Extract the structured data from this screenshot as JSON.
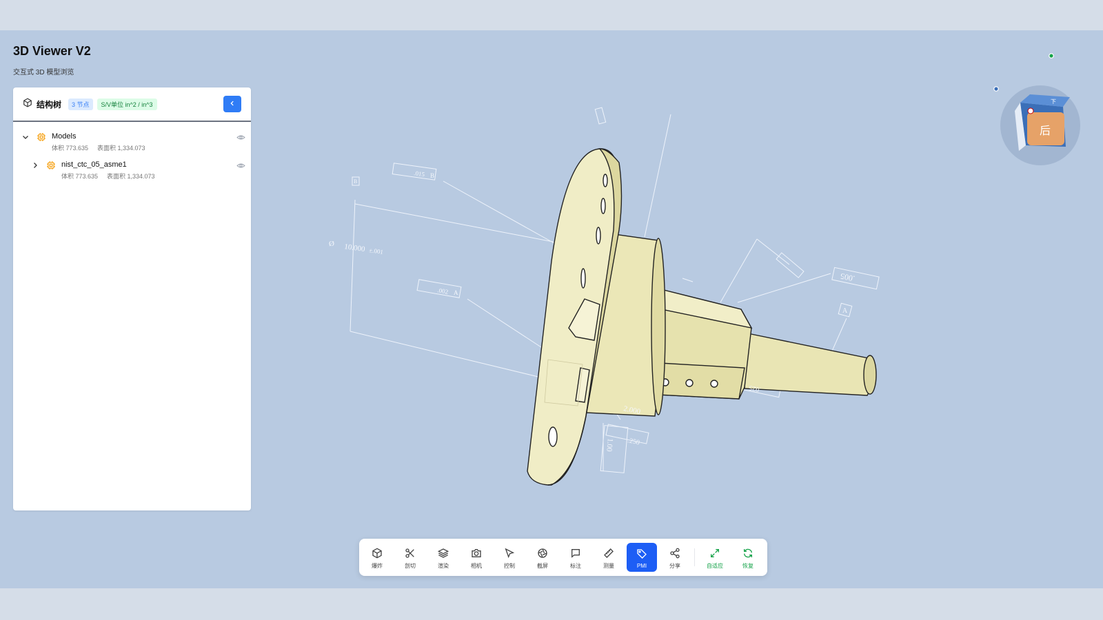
{
  "app": {
    "title": "3D Viewer V2",
    "subtitle": "交互式 3D 模型浏览"
  },
  "panel": {
    "title": "结构树",
    "nodes_badge": "3 节点",
    "units_badge": "S/V单位 in^2 / in^3",
    "tree": [
      {
        "name": "Models",
        "volume": "体积 773.635",
        "area": "表面积 1,334.073",
        "expanded": true
      },
      {
        "name": "nist_ctc_05_asme1",
        "volume": "体积 773.635",
        "area": "表面积 1,334.073",
        "expanded": false
      }
    ]
  },
  "pmi": {
    "dim_diameter_symbol": "Ø",
    "dim_diameter": "10.000",
    "dim_tol": "±.001",
    "fcf_1_tol": ".015",
    "fcf_1_datum": "B",
    "fcf_2_tol": ".002",
    "fcf_2_datum": "A",
    "datum_b": "B",
    "datum_a": "A",
    "fcf_3_tol": ".005",
    "fcf_4_tol": ".025",
    "dim_1": "2.000",
    "dim_2": ".250",
    "dim_3": "1.00"
  },
  "viewcube": {
    "face_label": "后",
    "top_label": "下"
  },
  "toolbar": {
    "items": [
      {
        "key": "explode",
        "label": "爆炸",
        "icon": "cube-icon"
      },
      {
        "key": "section",
        "label": "剖切",
        "icon": "scissors-icon"
      },
      {
        "key": "render",
        "label": "渲染",
        "icon": "layers-icon"
      },
      {
        "key": "camera",
        "label": "相机",
        "icon": "camera-icon"
      },
      {
        "key": "control",
        "label": "控制",
        "icon": "cursor-icon"
      },
      {
        "key": "screenshot",
        "label": "截屏",
        "icon": "aperture-icon"
      },
      {
        "key": "annotate",
        "label": "标注",
        "icon": "comment-icon"
      },
      {
        "key": "measure",
        "label": "测量",
        "icon": "ruler-icon"
      },
      {
        "key": "pmi",
        "label": "PMI",
        "icon": "tag-icon",
        "active": true
      },
      {
        "key": "share",
        "label": "分享",
        "icon": "share-icon"
      },
      {
        "key": "fit",
        "label": "自适应",
        "icon": "expand-icon"
      },
      {
        "key": "reset",
        "label": "恢复",
        "icon": "refresh-icon"
      }
    ]
  },
  "colors": {
    "accent": "#1d5ef5",
    "viewport": "#b8cae1",
    "model": "#ede9bd",
    "success": "#16a34a"
  }
}
